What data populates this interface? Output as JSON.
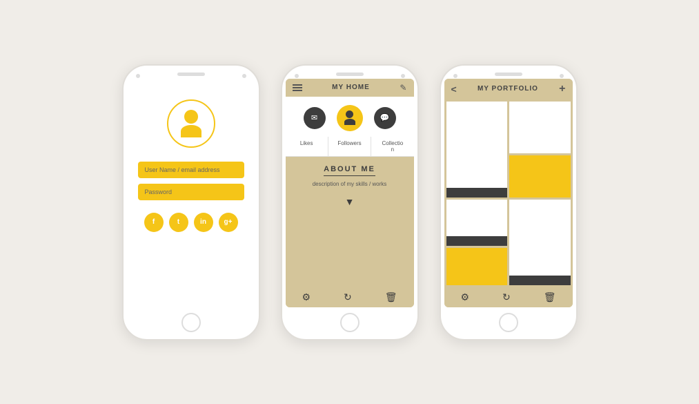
{
  "phone1": {
    "avatar_alt": "user avatar",
    "username_placeholder": "User Name / email address",
    "password_placeholder": "Password",
    "social": [
      "f",
      "t",
      "in",
      "g+"
    ]
  },
  "phone2": {
    "header_title": "MY HOME",
    "tabs": [
      "Likes",
      "Followers",
      "Collection"
    ],
    "about_title": "ABOUT ME",
    "about_desc": "description of my\nskills / works",
    "icons": [
      "gear",
      "refresh",
      "trash"
    ]
  },
  "phone3": {
    "header_title": "MY PORTFOLIO",
    "back_label": "<",
    "add_label": "+",
    "icons": [
      "gear",
      "refresh",
      "trash"
    ]
  }
}
